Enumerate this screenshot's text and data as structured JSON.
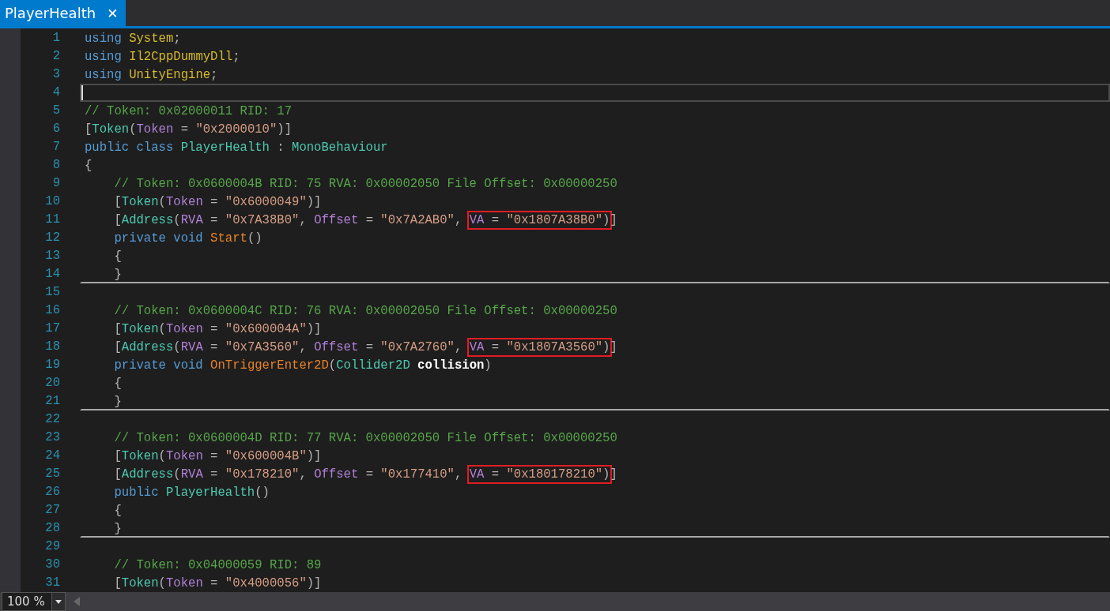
{
  "tab": {
    "title": "PlayerHealth",
    "selected": true,
    "close": "✕"
  },
  "lines": [
    {
      "n": "1",
      "current": false,
      "rule_below": false,
      "tokens": [
        {
          "text": "using ",
          "kind": "kw"
        },
        {
          "text": "System",
          "kind": "ns"
        },
        {
          "text": ";",
          "kind": "punct"
        }
      ]
    },
    {
      "n": "2",
      "current": false,
      "rule_below": false,
      "tokens": [
        {
          "text": "using ",
          "kind": "kw"
        },
        {
          "text": "Il2CppDummyDll",
          "kind": "ns"
        },
        {
          "text": ";",
          "kind": "punct"
        }
      ]
    },
    {
      "n": "3",
      "current": false,
      "rule_below": false,
      "tokens": [
        {
          "text": "using ",
          "kind": "kw"
        },
        {
          "text": "UnityEngine",
          "kind": "ns"
        },
        {
          "text": ";",
          "kind": "punct"
        }
      ]
    },
    {
      "n": "4",
      "current": true,
      "rule_below": false
    },
    {
      "n": "5",
      "current": false,
      "rule_below": false,
      "tokens": [
        {
          "text": "// Token: 0x02000011 RID: 17",
          "kind": "comment"
        }
      ]
    },
    {
      "n": "6",
      "current": false,
      "rule_below": false,
      "tokens": [
        {
          "text": "[",
          "kind": "punct"
        },
        {
          "text": "Token",
          "kind": "type"
        },
        {
          "text": "(",
          "kind": "punct"
        },
        {
          "text": "Token",
          "kind": "attr"
        },
        {
          "text": " = ",
          "kind": "punct"
        },
        {
          "text": "\"0x2000010\"",
          "kind": "str"
        },
        {
          "text": ")]",
          "kind": "punct"
        }
      ]
    },
    {
      "n": "7",
      "current": false,
      "rule_below": false,
      "tokens": [
        {
          "text": "public class ",
          "kind": "kw"
        },
        {
          "text": "PlayerHealth",
          "kind": "type"
        },
        {
          "text": " : ",
          "kind": "punct"
        },
        {
          "text": "MonoBehaviour",
          "kind": "type"
        }
      ]
    },
    {
      "n": "8",
      "current": false,
      "rule_below": false,
      "tokens": [
        {
          "text": "{",
          "kind": "punct"
        }
      ]
    },
    {
      "n": "9",
      "current": false,
      "rule_below": false,
      "tokens": [
        {
          "text": "    // Token: 0x0600004B RID: 75 RVA: 0x00002050 File Offset: 0x00000250",
          "kind": "comment"
        }
      ]
    },
    {
      "n": "10",
      "current": false,
      "rule_below": false,
      "tokens": [
        {
          "text": "    [",
          "kind": "punct"
        },
        {
          "text": "Token",
          "kind": "type"
        },
        {
          "text": "(",
          "kind": "punct"
        },
        {
          "text": "Token",
          "kind": "attr"
        },
        {
          "text": " = ",
          "kind": "punct"
        },
        {
          "text": "\"0x6000049\"",
          "kind": "str"
        },
        {
          "text": ")]",
          "kind": "punct"
        }
      ]
    },
    {
      "n": "11",
      "current": false,
      "rule_below": false,
      "tokens": [
        {
          "text": "    [",
          "kind": "punct"
        },
        {
          "text": "Address",
          "kind": "type"
        },
        {
          "text": "(",
          "kind": "punct"
        },
        {
          "text": "RVA",
          "kind": "attr"
        },
        {
          "text": " = ",
          "kind": "punct"
        },
        {
          "text": "\"0x7A38B0\"",
          "kind": "str"
        },
        {
          "text": ", ",
          "kind": "punct"
        },
        {
          "text": "Offset",
          "kind": "attr"
        },
        {
          "text": " = ",
          "kind": "punct"
        },
        {
          "text": "\"0x7A2AB0\"",
          "kind": "str"
        },
        {
          "text": ", ",
          "kind": "punct"
        },
        {
          "kind": "box",
          "tokens": [
            {
              "text": "VA",
              "kind": "attr"
            },
            {
              "text": " = ",
              "kind": "punct"
            },
            {
              "text": "\"0x1807A38B0\"",
              "kind": "str"
            },
            {
              "text": ")",
              "kind": "punct"
            }
          ]
        },
        {
          "text": "]",
          "kind": "punct"
        }
      ]
    },
    {
      "n": "12",
      "current": false,
      "rule_below": false,
      "tokens": [
        {
          "text": "    private void ",
          "kind": "kw"
        },
        {
          "text": "Start",
          "kind": "method"
        },
        {
          "text": "()",
          "kind": "punct"
        }
      ]
    },
    {
      "n": "13",
      "current": false,
      "rule_below": false,
      "tokens": [
        {
          "text": "    {",
          "kind": "punct"
        }
      ]
    },
    {
      "n": "14",
      "current": false,
      "rule_below": true,
      "tokens": [
        {
          "text": "    }",
          "kind": "punct"
        }
      ]
    },
    {
      "n": "15",
      "current": false,
      "rule_below": false
    },
    {
      "n": "16",
      "current": false,
      "rule_below": false,
      "tokens": [
        {
          "text": "    // Token: 0x0600004C RID: 76 RVA: 0x00002050 File Offset: 0x00000250",
          "kind": "comment"
        }
      ]
    },
    {
      "n": "17",
      "current": false,
      "rule_below": false,
      "tokens": [
        {
          "text": "    [",
          "kind": "punct"
        },
        {
          "text": "Token",
          "kind": "type"
        },
        {
          "text": "(",
          "kind": "punct"
        },
        {
          "text": "Token",
          "kind": "attr"
        },
        {
          "text": " = ",
          "kind": "punct"
        },
        {
          "text": "\"0x600004A\"",
          "kind": "str"
        },
        {
          "text": ")]",
          "kind": "punct"
        }
      ]
    },
    {
      "n": "18",
      "current": false,
      "rule_below": false,
      "tokens": [
        {
          "text": "    [",
          "kind": "punct"
        },
        {
          "text": "Address",
          "kind": "type"
        },
        {
          "text": "(",
          "kind": "punct"
        },
        {
          "text": "RVA",
          "kind": "attr"
        },
        {
          "text": " = ",
          "kind": "punct"
        },
        {
          "text": "\"0x7A3560\"",
          "kind": "str"
        },
        {
          "text": ", ",
          "kind": "punct"
        },
        {
          "text": "Offset",
          "kind": "attr"
        },
        {
          "text": " = ",
          "kind": "punct"
        },
        {
          "text": "\"0x7A2760\"",
          "kind": "str"
        },
        {
          "text": ", ",
          "kind": "punct"
        },
        {
          "kind": "box",
          "tokens": [
            {
              "text": "VA",
              "kind": "attr"
            },
            {
              "text": " = ",
              "kind": "punct"
            },
            {
              "text": "\"0x1807A3560\"",
              "kind": "str"
            },
            {
              "text": ")",
              "kind": "punct"
            }
          ]
        },
        {
          "text": "]",
          "kind": "punct"
        }
      ]
    },
    {
      "n": "19",
      "current": false,
      "rule_below": false,
      "tokens": [
        {
          "text": "    private void ",
          "kind": "kw"
        },
        {
          "text": "OnTriggerEnter2D",
          "kind": "method"
        },
        {
          "text": "(",
          "kind": "punct"
        },
        {
          "text": "Collider2D",
          "kind": "type"
        },
        {
          "text": " collision",
          "kind": "param"
        },
        {
          "text": ")",
          "kind": "punct"
        }
      ]
    },
    {
      "n": "20",
      "current": false,
      "rule_below": false,
      "tokens": [
        {
          "text": "    {",
          "kind": "punct"
        }
      ]
    },
    {
      "n": "21",
      "current": false,
      "rule_below": true,
      "tokens": [
        {
          "text": "    }",
          "kind": "punct"
        }
      ]
    },
    {
      "n": "22",
      "current": false,
      "rule_below": false
    },
    {
      "n": "23",
      "current": false,
      "rule_below": false,
      "tokens": [
        {
          "text": "    // Token: 0x0600004D RID: 77 RVA: 0x00002050 File Offset: 0x00000250",
          "kind": "comment"
        }
      ]
    },
    {
      "n": "24",
      "current": false,
      "rule_below": false,
      "tokens": [
        {
          "text": "    [",
          "kind": "punct"
        },
        {
          "text": "Token",
          "kind": "type"
        },
        {
          "text": "(",
          "kind": "punct"
        },
        {
          "text": "Token",
          "kind": "attr"
        },
        {
          "text": " = ",
          "kind": "punct"
        },
        {
          "text": "\"0x600004B\"",
          "kind": "str"
        },
        {
          "text": ")]",
          "kind": "punct"
        }
      ]
    },
    {
      "n": "25",
      "current": false,
      "rule_below": false,
      "tokens": [
        {
          "text": "    [",
          "kind": "punct"
        },
        {
          "text": "Address",
          "kind": "type"
        },
        {
          "text": "(",
          "kind": "punct"
        },
        {
          "text": "RVA",
          "kind": "attr"
        },
        {
          "text": " = ",
          "kind": "punct"
        },
        {
          "text": "\"0x178210\"",
          "kind": "str"
        },
        {
          "text": ", ",
          "kind": "punct"
        },
        {
          "text": "Offset",
          "kind": "attr"
        },
        {
          "text": " = ",
          "kind": "punct"
        },
        {
          "text": "\"0x177410\"",
          "kind": "str"
        },
        {
          "text": ", ",
          "kind": "punct"
        },
        {
          "kind": "box",
          "tokens": [
            {
              "text": "VA",
              "kind": "attr"
            },
            {
              "text": " = ",
              "kind": "punct"
            },
            {
              "text": "\"0x180178210\"",
              "kind": "str"
            },
            {
              "text": ")",
              "kind": "punct"
            }
          ]
        },
        {
          "text": "]",
          "kind": "punct"
        }
      ]
    },
    {
      "n": "26",
      "current": false,
      "rule_below": false,
      "tokens": [
        {
          "text": "    public ",
          "kind": "kw"
        },
        {
          "text": "PlayerHealth",
          "kind": "type"
        },
        {
          "text": "()",
          "kind": "punct"
        }
      ]
    },
    {
      "n": "27",
      "current": false,
      "rule_below": false,
      "tokens": [
        {
          "text": "    {",
          "kind": "punct"
        }
      ]
    },
    {
      "n": "28",
      "current": false,
      "rule_below": true,
      "tokens": [
        {
          "text": "    }",
          "kind": "punct"
        }
      ]
    },
    {
      "n": "29",
      "current": false,
      "rule_below": false
    },
    {
      "n": "30",
      "current": false,
      "rule_below": false,
      "tokens": [
        {
          "text": "    // Token: 0x04000059 RID: 89",
          "kind": "comment"
        }
      ]
    },
    {
      "n": "31",
      "current": false,
      "rule_below": false,
      "tokens": [
        {
          "text": "    [",
          "kind": "punct"
        },
        {
          "text": "Token",
          "kind": "type"
        },
        {
          "text": "(",
          "kind": "punct"
        },
        {
          "text": "Token",
          "kind": "attr"
        },
        {
          "text": " = ",
          "kind": "punct"
        },
        {
          "text": "\"0x4000056\"",
          "kind": "str"
        },
        {
          "text": ")]",
          "kind": "punct"
        }
      ]
    }
  ],
  "status": {
    "zoom": "100 %"
  }
}
